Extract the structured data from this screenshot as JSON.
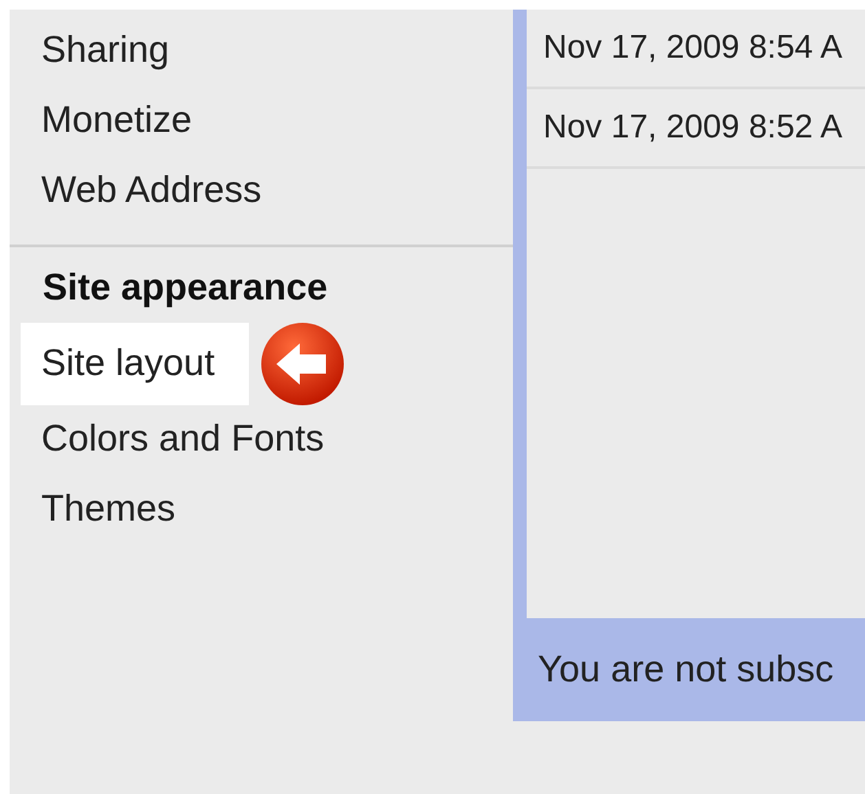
{
  "sidebar": {
    "items": [
      {
        "label": "Sharing",
        "kind": "link",
        "selected": false
      },
      {
        "label": "Monetize",
        "kind": "link",
        "selected": false
      },
      {
        "label": "Web Address",
        "kind": "link",
        "selected": false
      },
      {
        "kind": "divider"
      },
      {
        "label": "Site appearance",
        "kind": "heading"
      },
      {
        "label": "Site layout",
        "kind": "link",
        "selected": true
      },
      {
        "label": "Colors and Fonts",
        "kind": "link",
        "selected": false
      },
      {
        "label": "Themes",
        "kind": "link",
        "selected": false
      }
    ]
  },
  "feed": {
    "rows": [
      {
        "date": "Nov 17, 2009 8:54 A"
      },
      {
        "date": "Nov 17, 2009 8:52 A"
      }
    ],
    "footer": "You are not subsc"
  }
}
